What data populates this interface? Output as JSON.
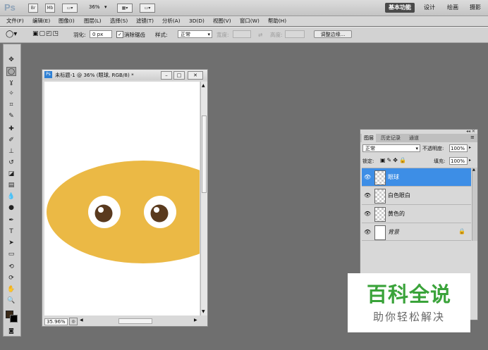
{
  "topbar": {
    "logo": "Ps",
    "buttons": [
      "Br",
      "Mb"
    ],
    "zoom": "36%",
    "workspaces": [
      "基本功能",
      "设计",
      "绘画",
      "摄影"
    ]
  },
  "menu": [
    "文件(F)",
    "编辑(E)",
    "图像(I)",
    "图层(L)",
    "选择(S)",
    "滤镜(T)",
    "分析(A)",
    "3D(D)",
    "视图(V)",
    "窗口(W)",
    "帮助(H)"
  ],
  "options": {
    "feather_label": "羽化:",
    "feather_value": "0 px",
    "antialias_label": "消除锯齿",
    "style_label": "样式:",
    "style_value": "正常",
    "width_label": "宽度:",
    "height_label": "高度:",
    "refine_edge_button": "调整边缘..."
  },
  "document": {
    "title": "未标题-1 @ 36% (眼球, RGB/8) *",
    "zoom_status": "35.96%"
  },
  "layers_panel": {
    "tabs": [
      "图层",
      "历史记录",
      "通道"
    ],
    "blend_mode": "正常",
    "opacity_label": "不透明度:",
    "opacity_value": "100%",
    "lock_label": "锁定:",
    "fill_label": "填充:",
    "fill_value": "100%",
    "layers": [
      {
        "name": "眼球",
        "selected": true
      },
      {
        "name": "白色眼白",
        "selected": false
      },
      {
        "name": "黄色的",
        "selected": false
      },
      {
        "name": "背景",
        "selected": false,
        "locked": true
      }
    ]
  },
  "watermark": {
    "title": "百科全说",
    "subtitle": "助你轻松解决"
  },
  "colors": {
    "ellipse": "#ebb945",
    "eye_white": "#ffffff",
    "pupil": "#5a3a1e",
    "selected_layer": "#3d8ee6",
    "watermark_green": "#3aa33a"
  }
}
